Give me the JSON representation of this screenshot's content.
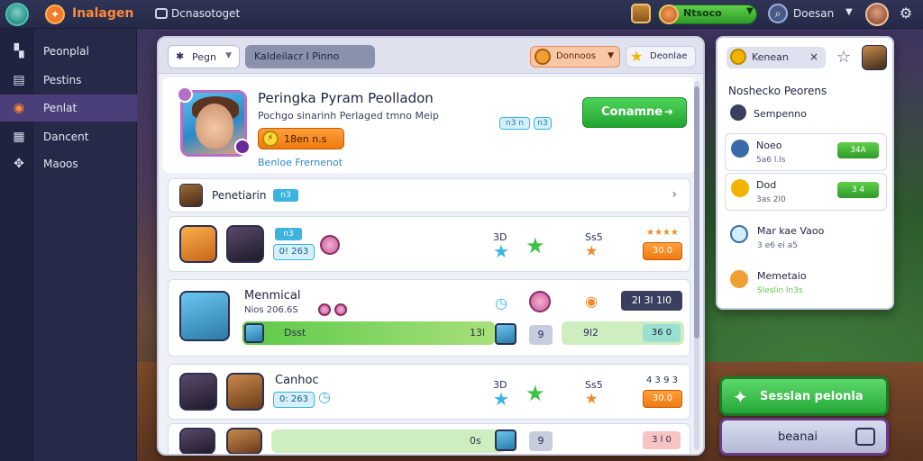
{
  "topbar": {
    "app_title": "Inalagen",
    "network_label": "Dcnasotoget",
    "currency_label": "Ntsoco",
    "region_label": "Doesan"
  },
  "sidebar": {
    "items": [
      {
        "label": "Peonplal",
        "icon": "map-icon"
      },
      {
        "label": "Pestins",
        "icon": "list-icon"
      },
      {
        "label": "Penlat",
        "icon": "target-icon",
        "active": true
      },
      {
        "label": "Dancent",
        "icon": "chart-icon"
      },
      {
        "label": "Maoos",
        "icon": "controller-icon"
      }
    ]
  },
  "toolbar": {
    "filter_label": "Pegn",
    "tab_label": "Kaldeilacr I Pinno",
    "coins_label": "Donnoos",
    "star_label": "Deonlae"
  },
  "header": {
    "name": "Peringka Pyram Peolladon",
    "subtitle": "Pochgo sinarinh Perlaged tmno Meip",
    "energy_label": "18en n.s",
    "link_label": "Benloe Frernenot",
    "tag1": "n3 n",
    "tag2": "n3",
    "continue_label": "Conamne"
  },
  "section": {
    "label": "Penetiarin",
    "tag": "n3"
  },
  "matches": [
    {
      "tag": "n3",
      "score": "0! 263",
      "num1": "3D",
      "num2": "Ss5",
      "stars": "★★★★",
      "orange": "30.0"
    },
    {
      "name": "Menmical",
      "sub": "Nios 206.6S",
      "progress_label": "Dsst",
      "progress_num": "13l",
      "dark_pill": "2l 3l 1l0",
      "gray_btn": "9",
      "right_num": "9l2",
      "teal": "36 0"
    },
    {
      "name": "Canhoc",
      "score": "0: 263",
      "num1": "3D",
      "num2": "Ss5",
      "stars": "4 3 9 3",
      "orange": "30.0"
    },
    {
      "progress_num": "0s",
      "gray_btn": "9",
      "pink": "3 l 0"
    }
  ],
  "right_panel": {
    "search_label": "Kenean",
    "title": "Noshecko Peorens",
    "subhead": "Sempenno",
    "cards": [
      {
        "name": "Noeo",
        "sub": "5a6 l.ls",
        "pill": "34A"
      },
      {
        "name": "Dod",
        "sub": "3as 2l0",
        "pill": "3 4"
      }
    ],
    "plain": [
      {
        "name": "Mar kae Vaoo",
        "sub": "3 e6 ei a5"
      },
      {
        "name": "Memetaio",
        "sub": "Sleslin ln3s"
      }
    ]
  },
  "buttons": {
    "green_label": "Sesslan pelonla",
    "gray_label": "beanai"
  }
}
